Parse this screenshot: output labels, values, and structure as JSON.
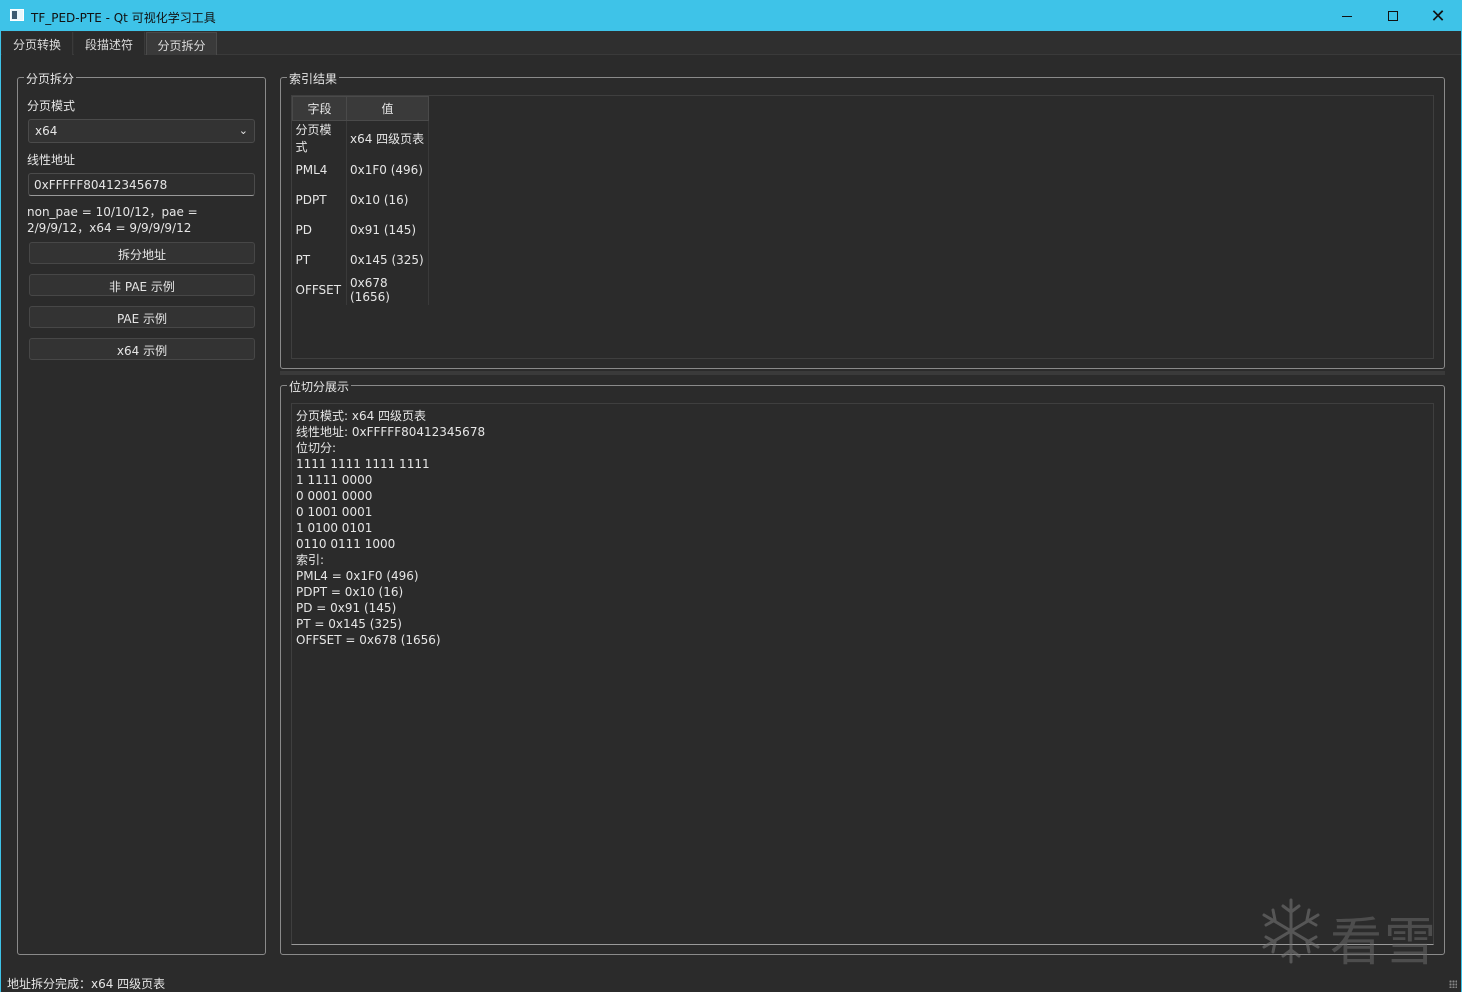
{
  "window": {
    "title": "TF_PED-PTE - Qt 可视化学习工具",
    "accent_color": "#3ec3e8",
    "controls": {
      "minimize": "minimize-icon",
      "maximize": "maximize-icon",
      "close": "close-icon"
    }
  },
  "tabs": [
    {
      "label": "分页转换",
      "active": false
    },
    {
      "label": "段描述符",
      "active": false
    },
    {
      "label": "分页拆分",
      "active": true
    }
  ],
  "left_panel": {
    "title": "分页拆分",
    "mode_label": "分页模式",
    "mode_value": "x64",
    "addr_label": "线性地址",
    "addr_value": "0xFFFFF80412345678",
    "hint": "non_pae = 10/10/12，pae = 2/9/9/12，x64 = 9/9/9/9/12",
    "buttons": {
      "split": "拆分地址",
      "non_pae": "非 PAE 示例",
      "pae": "PAE 示例",
      "x64": "x64 示例"
    }
  },
  "index_result": {
    "title": "索引结果",
    "headers": [
      "字段",
      "值"
    ],
    "rows": [
      [
        "分页模式",
        "x64 四级页表"
      ],
      [
        "PML4",
        "0x1F0 (496)"
      ],
      [
        "PDPT",
        "0x10 (16)"
      ],
      [
        "PD",
        "0x91 (145)"
      ],
      [
        "PT",
        "0x145 (325)"
      ],
      [
        "OFFSET",
        "0x678 (1656)"
      ]
    ]
  },
  "bit_split": {
    "title": "位切分展示",
    "lines": [
      "分页模式: x64 四级页表",
      "线性地址: 0xFFFFF80412345678",
      "位切分:",
      "1111 1111 1111 1111",
      "1 1111 0000",
      "0 0001 0000",
      "0 1001 0001",
      "1 0100 0101",
      "0110 0111 1000",
      "索引:",
      "PML4 = 0x1F0 (496)",
      "PDPT = 0x10 (16)",
      "PD = 0x91 (145)",
      "PT = 0x145 (325)",
      "OFFSET = 0x678 (1656)"
    ]
  },
  "status": {
    "text": "地址拆分完成：x64 四级页表"
  },
  "watermark": {
    "text": "看雪",
    "icon": "snowflake-icon"
  }
}
